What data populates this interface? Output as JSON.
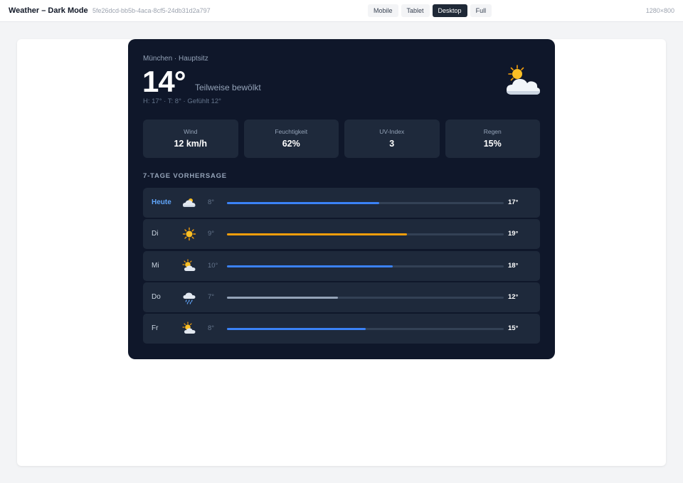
{
  "header": {
    "title": "Weather – Dark Mode",
    "id": "5fe26dcd-bb5b-4aca-8cf5-24db31d2a797",
    "viewport_tabs": [
      {
        "label": "Mobile",
        "active": false
      },
      {
        "label": "Tablet",
        "active": false
      },
      {
        "label": "Desktop",
        "active": true
      },
      {
        "label": "Full",
        "active": false
      }
    ],
    "dimensions": "1280×800"
  },
  "weather": {
    "location": "München · Hauptsitz",
    "temperature": "14°",
    "condition": "Teilweise bewölkt",
    "details": "H: 17° · T: 8° · Gefühlt 12°",
    "icon": "partly-cloudy-icon",
    "stats": [
      {
        "label": "Wind",
        "value": "12 km/h"
      },
      {
        "label": "Feuchtigkeit",
        "value": "62%"
      },
      {
        "label": "UV-Index",
        "value": "3"
      },
      {
        "label": "Regen",
        "value": "15%"
      }
    ],
    "forecast_title": "7-TAGE VORHERSAGE",
    "forecast": [
      {
        "day": "Heute",
        "icon": "cloudy-icon",
        "low": "8°",
        "high": "17°",
        "bar_fraction": 0.55,
        "bar_color": "#3b82f6",
        "today": true
      },
      {
        "day": "Di",
        "icon": "sun-icon",
        "low": "9°",
        "high": "19°",
        "bar_fraction": 0.65,
        "bar_color": "#f59e0b",
        "today": false
      },
      {
        "day": "Mi",
        "icon": "sun-cloud-icon",
        "low": "10°",
        "high": "18°",
        "bar_fraction": 0.6,
        "bar_color": "#3b82f6",
        "today": false
      },
      {
        "day": "Do",
        "icon": "rain-cloud-icon",
        "low": "7°",
        "high": "12°",
        "bar_fraction": 0.4,
        "bar_color": "#94a3b8",
        "today": false
      },
      {
        "day": "Fr",
        "icon": "sun-cloud-icon",
        "low": "8°",
        "high": "15°",
        "bar_fraction": 0.5,
        "bar_color": "#3b82f6",
        "today": false
      }
    ]
  }
}
